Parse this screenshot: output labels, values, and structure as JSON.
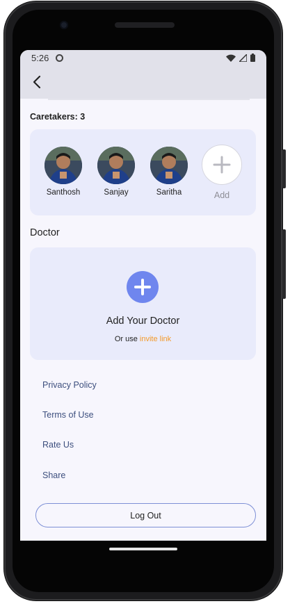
{
  "status_bar": {
    "time": "5:26"
  },
  "caretakers": {
    "title": "Caretakers: 3",
    "people": [
      {
        "name": "Santhosh"
      },
      {
        "name": "Sanjay"
      },
      {
        "name": "Saritha"
      }
    ],
    "add_label": "Add"
  },
  "doctor": {
    "section_title": "Doctor",
    "add_text": "Add Your Doctor",
    "invite_prefix": "Or use ",
    "invite_link": "invite link"
  },
  "menu": {
    "items": [
      {
        "label": "Privacy Policy"
      },
      {
        "label": "Terms of Use"
      },
      {
        "label": "Rate Us"
      },
      {
        "label": "Share"
      }
    ]
  },
  "logout": {
    "label": "Log Out"
  },
  "colors": {
    "accent": "#6f86ee",
    "link": "#f39a2a",
    "card_bg": "#e9ebfb",
    "menu_text": "#3d4f7e"
  }
}
